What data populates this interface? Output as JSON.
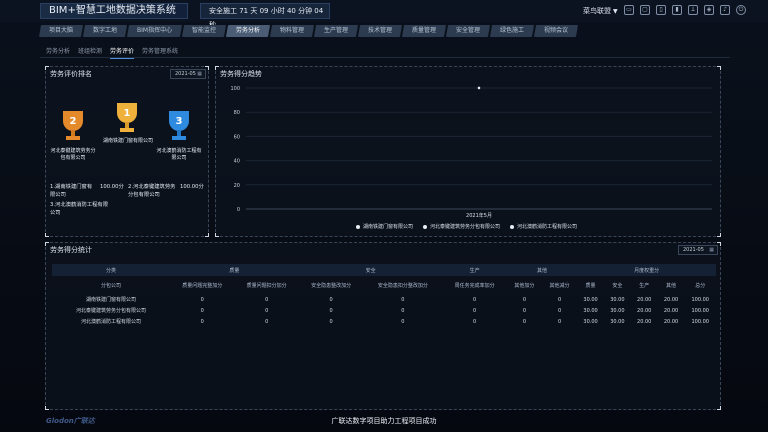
{
  "header": {
    "app_title": "BIM+智慧工地数据决策系统",
    "safety_text": "安全施工 71 天 09 小时 40 分钟 04 秒",
    "user_name": "菜鸟联盟",
    "icons": [
      "monitor-icon",
      "screen-icon",
      "tablet-icon",
      "mobile-icon",
      "shirt-icon",
      "shield-icon",
      "bell-icon",
      "power-icon"
    ]
  },
  "nav": {
    "tabs": [
      "项目大脑",
      "数字工地",
      "BIM指挥中心",
      "智能监控",
      "劳务分析",
      "物料管理",
      "生产管理",
      "技术管理",
      "质量管理",
      "安全管理",
      "绿色施工",
      "视频会议"
    ],
    "active_tab": "劳务分析",
    "subtabs": [
      "劳务分析",
      "班组检测",
      "劳务评价",
      "劳务管理系统"
    ],
    "active_subtab": "劳务评价"
  },
  "ranking": {
    "title": "劳务评价排名",
    "date": "2021-05",
    "podium": [
      {
        "rank": "2",
        "company": "河北泰键建筑劳务分包有限公司"
      },
      {
        "rank": "1",
        "company": "湖南铁建门窗有限公司"
      },
      {
        "rank": "3",
        "company": "河北澳鹤消防工程有限公司"
      }
    ],
    "list": [
      {
        "name": "1.湖南铁建门窗有限公司",
        "score": "100.00分"
      },
      {
        "name": "2.河北泰键建筑劳务分包有限公司",
        "score": "100.00分"
      },
      {
        "name": "3.河北澳鹤消防工程有限公司",
        "score": ""
      }
    ]
  },
  "trend": {
    "title": "劳务得分趋势",
    "chart_data": {
      "type": "scatter",
      "x": [
        "2021年5月"
      ],
      "series": [
        {
          "name": "湖南铁建门窗有限公司",
          "values": [
            100
          ]
        },
        {
          "name": "河北泰键建筑劳务分包有限公司",
          "values": [
            100
          ]
        },
        {
          "name": "河北澳鹤消防工程有限公司",
          "values": [
            100
          ]
        }
      ],
      "ylim": [
        0,
        100
      ],
      "yticks": [
        "100",
        "80",
        "60",
        "40",
        "20",
        "0"
      ],
      "legend_position": "bottom"
    }
  },
  "stats": {
    "title": "劳务得分统计",
    "date": "2021-05",
    "group_headers": [
      "分类",
      "质量",
      "安全",
      "生产",
      "其他",
      "月度权重分"
    ],
    "col_headers": [
      "分包公司",
      "质量问题完整加分",
      "质量问题扣分加分",
      "安全隐患整改加分",
      "安全隐患扣分整改加分",
      "周任务完成率加分",
      "其他加分",
      "其他减分",
      "质量",
      "安全",
      "生产",
      "其他",
      "总分"
    ],
    "rows": [
      [
        "湖南铁建门窗有限公司",
        "0",
        "0",
        "0",
        "0",
        "0",
        "0",
        "0",
        "30.00",
        "30.00",
        "20.00",
        "20.00",
        "100.00"
      ],
      [
        "河北泰键建筑劳务分包有限公司",
        "0",
        "0",
        "0",
        "0",
        "0",
        "0",
        "0",
        "30.00",
        "30.00",
        "20.00",
        "20.00",
        "100.00"
      ],
      [
        "河北澳鹤消防工程有限公司",
        "0",
        "0",
        "0",
        "0",
        "0",
        "0",
        "0",
        "30.00",
        "30.00",
        "20.00",
        "20.00",
        "100.00"
      ]
    ]
  },
  "footer": {
    "logo": "Glodon广联达",
    "slogan": "广联达数字项目助力工程项目成功"
  }
}
